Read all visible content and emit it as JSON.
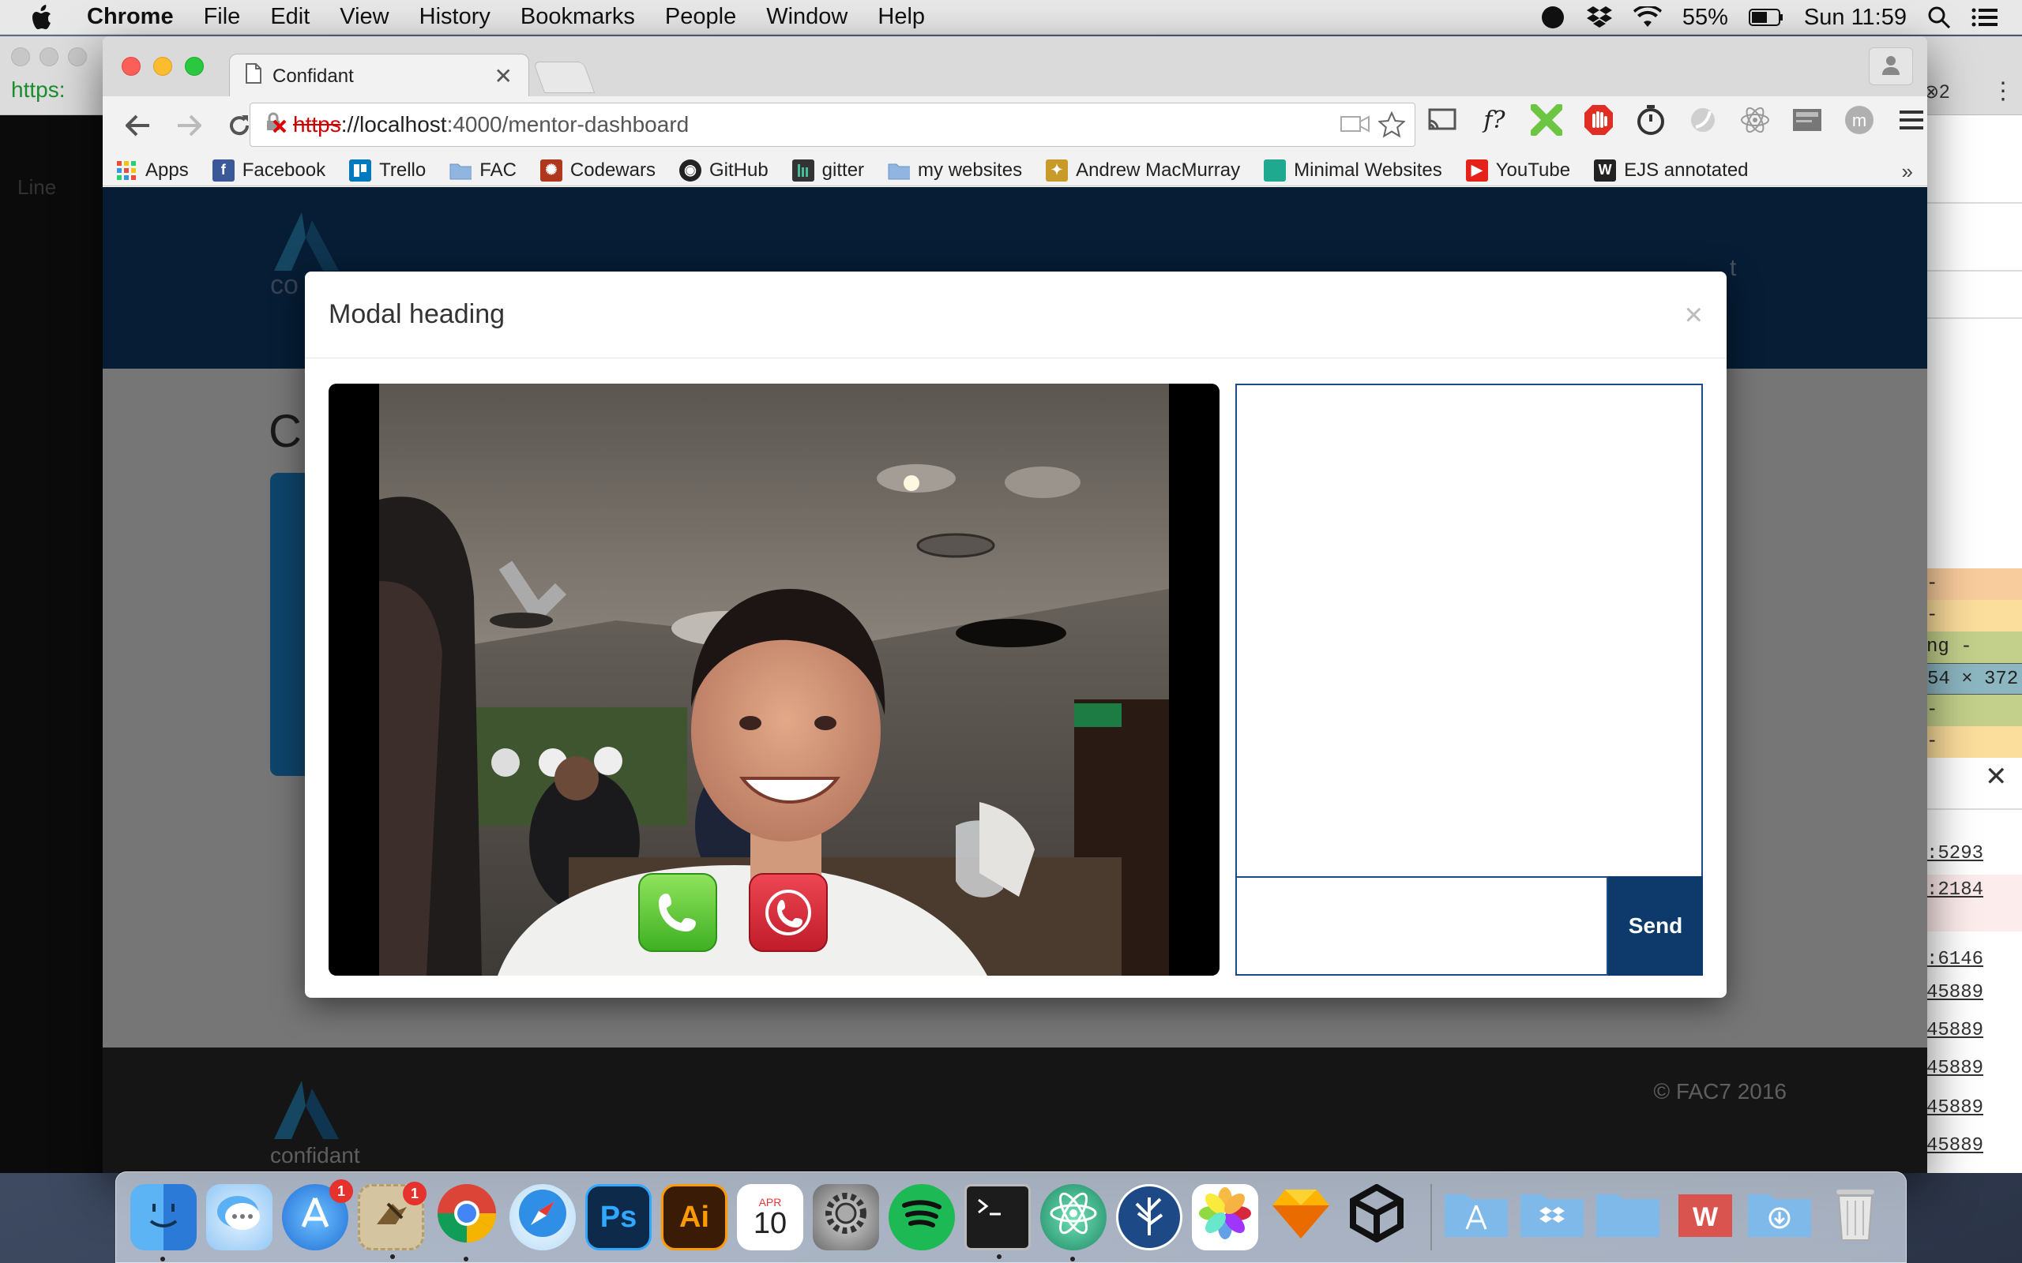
{
  "menubar": {
    "app": "Chrome",
    "items": [
      "File",
      "Edit",
      "View",
      "History",
      "Bookmarks",
      "People",
      "Window",
      "Help"
    ],
    "battery": "55%",
    "clock": "Sun 11:59"
  },
  "bg_left": {
    "url": "https:",
    "line": "Line"
  },
  "bg_right": {
    "rows": [
      "-",
      "-",
      "ng -",
      "54 × 372",
      "-",
      "-"
    ],
    "lines": [
      ":5293",
      ":2184",
      ":6146",
      "45889",
      "45889",
      "45889",
      "45889",
      "45889"
    ],
    "badge": "2"
  },
  "browser": {
    "tab_title": "Confidant",
    "url_scheme": "https",
    "url_host": "://localhost",
    "url_path": ":4000/mentor-dashboard",
    "bookmarks": [
      {
        "label": "Apps",
        "color": "#e74c3c"
      },
      {
        "label": "Facebook",
        "color": "#3b5998"
      },
      {
        "label": "Trello",
        "color": "#0079bf"
      },
      {
        "label": "FAC",
        "color": "#8fb5e0"
      },
      {
        "label": "Codewars",
        "color": "#b1361e"
      },
      {
        "label": "GitHub",
        "color": "#222222"
      },
      {
        "label": "gitter",
        "color": "#333333"
      },
      {
        "label": "my websites",
        "color": "#8fb5e0"
      },
      {
        "label": "Andrew MacMurray",
        "color": "#c79a2a"
      },
      {
        "label": "Minimal Websites",
        "color": "#1fa98f"
      },
      {
        "label": "YouTube",
        "color": "#e62117"
      },
      {
        "label": "EJS annotated",
        "color": "#222222"
      }
    ],
    "more": "»"
  },
  "site": {
    "logo_text": "confidant",
    "header_logo_text": "co",
    "heading_partial": "C",
    "nav_partial": "t",
    "footer_copy": "© FAC7 2016"
  },
  "modal": {
    "title": "Modal heading",
    "close": "×",
    "send_label": "Send",
    "chat_input_value": ""
  },
  "dock": {
    "items": [
      {
        "name": "Finder",
        "color": "#3a8ee6",
        "badge": "",
        "running": true
      },
      {
        "name": "Messages",
        "color": "#5ab0f5",
        "badge": "",
        "running": false
      },
      {
        "name": "App Store",
        "color": "#1f7fe0",
        "badge": "1",
        "running": false
      },
      {
        "name": "Mail",
        "color": "#c9b48a",
        "badge": "1",
        "running": true
      },
      {
        "name": "Chrome",
        "color": "#f4f4f4",
        "badge": "",
        "running": true
      },
      {
        "name": "Safari",
        "color": "#2f8fe6",
        "badge": "",
        "running": false
      },
      {
        "name": "Photoshop",
        "color": "#0d2a4a",
        "badge": "",
        "running": false
      },
      {
        "name": "Illustrator",
        "color": "#3a1c06",
        "badge": "",
        "running": false
      },
      {
        "name": "Calendar",
        "color": "#ffffff",
        "badge": "",
        "running": false
      },
      {
        "name": "System Preferences",
        "color": "#8a8a8a",
        "badge": "",
        "running": false
      },
      {
        "name": "Spotify",
        "color": "#1db954",
        "badge": "",
        "running": false
      },
      {
        "name": "Terminal",
        "color": "#1c1c1c",
        "badge": "",
        "running": true
      },
      {
        "name": "Atom",
        "color": "#2ca37a",
        "badge": "",
        "running": true
      },
      {
        "name": "SourceTree",
        "color": "#1d4a86",
        "badge": "",
        "running": false
      },
      {
        "name": "Photos",
        "color": "#ffffff",
        "badge": "",
        "running": false
      },
      {
        "name": "Sketch",
        "color": "#f7b32b",
        "badge": "",
        "running": false
      },
      {
        "name": "Unity",
        "color": "#f4f4f4",
        "badge": "",
        "running": false
      }
    ],
    "folders": [
      {
        "name": "Applications",
        "color": "#7fb9e9"
      },
      {
        "name": "Dropbox",
        "color": "#7fb9e9"
      },
      {
        "name": "Documents",
        "color": "#7fb9e9"
      },
      {
        "name": "Word",
        "color": "#d9534f"
      },
      {
        "name": "Downloads",
        "color": "#7fb9e9"
      },
      {
        "name": "Trash",
        "color": "#d5d5d5"
      }
    ],
    "calendar_month": "APR",
    "calendar_day": "10",
    "ps": "Ps",
    "ai": "Ai"
  },
  "colors": {
    "navy": "#0d3a6b",
    "accept": "#3fb022",
    "hangup": "#c01c2a"
  }
}
